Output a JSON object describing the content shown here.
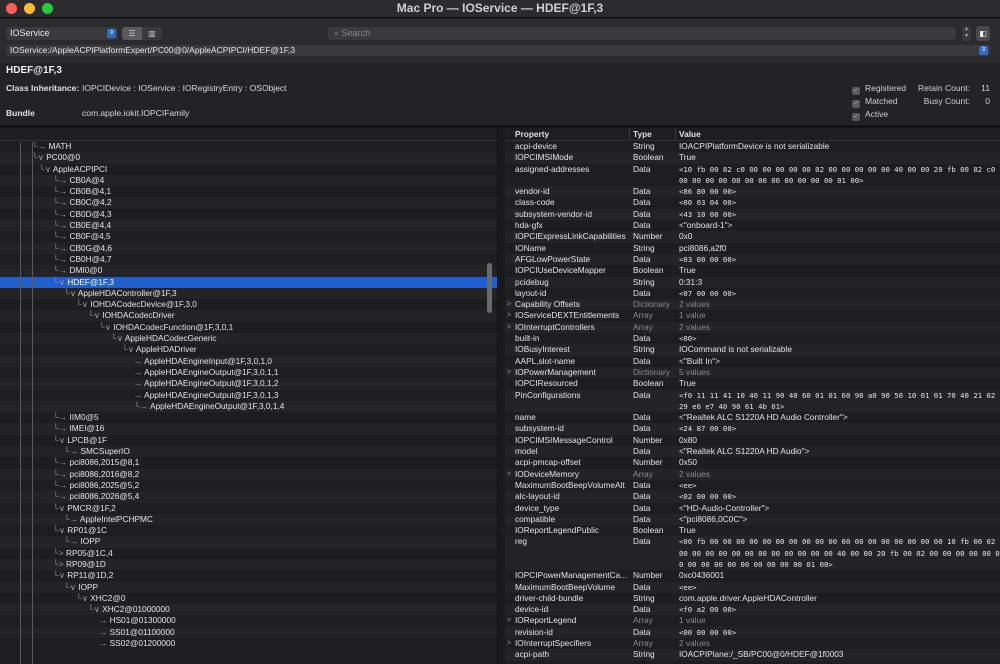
{
  "window": {
    "title": "Mac Pro — IOService — HDEF@1F,3"
  },
  "toolbar": {
    "plane": "IOService",
    "search_placeholder": "Search",
    "view_list_icon": "list-view-icon",
    "view_columns_icon": "column-view-icon",
    "path": "IOService:/AppleACPIPlatformExpert/PC00@0/AppleACPIPCI/HDEF@1F,3"
  },
  "info": {
    "name": "HDEF@1F,3",
    "class_label": "Class Inheritance:",
    "class_value": "IOPCIDevice : IOService : IORegistryEntry : OSObject",
    "bundle_label": "Bundle",
    "bundle_value": "com.apple.iokit.IOPCIFamily",
    "registered": "Registered",
    "matched": "Matched",
    "active": "Active",
    "retain_label": "Retain Count:",
    "retain_value": "11",
    "busy_label": "Busy Count:",
    "busy_value": "0"
  },
  "tree": [
    {
      "label": "MATH",
      "prefix": "└→ "
    },
    {
      "label": "PC00@0",
      "prefix": "└∨ "
    },
    {
      "label": "AppleACPIPCI",
      "prefix": "└∨ "
    },
    {
      "label": "CB0A@4",
      "prefix": "└→ "
    },
    {
      "label": "CB0B@4,1",
      "prefix": "└→ "
    },
    {
      "label": "CB0C@4,2",
      "prefix": "└→ "
    },
    {
      "label": "CB0D@4,3",
      "prefix": "└→ "
    },
    {
      "label": "CB0E@4,4",
      "prefix": "└→ "
    },
    {
      "label": "CB0F@4,5",
      "prefix": "└→ "
    },
    {
      "label": "CB0G@4,6",
      "prefix": "└→ "
    },
    {
      "label": "CB0H@4,7",
      "prefix": "└→ "
    },
    {
      "label": "DMI0@0",
      "prefix": "└→ "
    },
    {
      "label": "HDEF@1F,3",
      "prefix": "└∨ "
    },
    {
      "label": "AppleHDAController@1F,3",
      "prefix": "└∨ "
    },
    {
      "label": "IOHDACodecDevice@1F,3,0",
      "prefix": "└∨ "
    },
    {
      "label": "IOHDACodecDriver",
      "prefix": "└∨ "
    },
    {
      "label": "IOHDACodecFunction@1F,3,0,1",
      "prefix": "└∨ "
    },
    {
      "label": "AppleHDACodecGeneric",
      "prefix": "└∨ "
    },
    {
      "label": "AppleHDADriver",
      "prefix": "└∨ "
    },
    {
      "label": "AppleHDAEngineInput@1F,3,0,1,0",
      "prefix": "→ "
    },
    {
      "label": "AppleHDAEngineOutput@1F,3,0,1,1",
      "prefix": "→ "
    },
    {
      "label": "AppleHDAEngineOutput@1F,3,0,1,2",
      "prefix": "→ "
    },
    {
      "label": "AppleHDAEngineOutput@1F,3,0,1,3",
      "prefix": "→ "
    },
    {
      "label": "AppleHDAEngineOutput@1F,3,0,1,4",
      "prefix": "└→ "
    },
    {
      "label": "IIM0@5",
      "prefix": "└→ "
    },
    {
      "label": "IMEI@16",
      "prefix": "└→ "
    },
    {
      "label": "LPCB@1F",
      "prefix": "└∨ "
    },
    {
      "label": "SMCSuperIO",
      "prefix": "└→ "
    },
    {
      "label": "pci8086,2015@8,1",
      "prefix": "└→ "
    },
    {
      "label": "pci8086,2016@8,2",
      "prefix": "└→ "
    },
    {
      "label": "pci8086,2025@5,2",
      "prefix": "└→ "
    },
    {
      "label": "pci8086,2026@5,4",
      "prefix": "└→ "
    },
    {
      "label": "PMCR@1F,2",
      "prefix": "└∨ "
    },
    {
      "label": "AppleIntelPCHPMC",
      "prefix": "└→ "
    },
    {
      "label": "RP01@1C",
      "prefix": "└∨ "
    },
    {
      "label": "IOPP",
      "prefix": "└→ "
    },
    {
      "label": "RP05@1C,4",
      "prefix": "└> "
    },
    {
      "label": "RP09@1D",
      "prefix": "└> "
    },
    {
      "label": "RP11@1D,2",
      "prefix": "└∨ "
    },
    {
      "label": "IOPP",
      "prefix": "└∨ "
    },
    {
      "label": "XHC2@0",
      "prefix": "└∨ "
    },
    {
      "label": "XHC2@01000000",
      "prefix": "└∨ "
    },
    {
      "label": "HS01@01300000",
      "prefix": "→ "
    },
    {
      "label": "SS01@01100000",
      "prefix": "→ "
    },
    {
      "label": "SS02@01200000",
      "prefix": "→ "
    }
  ],
  "props_header": {
    "property": "Property",
    "type": "Type",
    "value": "Value"
  },
  "props": [
    {
      "p": "acpi-device",
      "t": "String",
      "v": "IOACPIPlatformDevice is not serializable",
      "mono": false
    },
    {
      "p": "IOPCIMSIMode",
      "t": "Boolean",
      "v": "True",
      "mono": false
    },
    {
      "p": "assigned-addresses",
      "t": "Data",
      "v": "<10 fb 00 82 c0 00 00 00 00 00 02 00 00 00 00 00 40 00 00 20 fb 00 82 c0 00 00 00 00 00 00 00 00 00 00 00 00 01 00>",
      "mono": true,
      "h": 3
    },
    {
      "p": "vendor-id",
      "t": "Data",
      "v": "<86 80 00 00>",
      "mono": true
    },
    {
      "p": "class-code",
      "t": "Data",
      "v": "<00 03 04 00>",
      "mono": true
    },
    {
      "p": "subsystem-vendor-id",
      "t": "Data",
      "v": "<43 10 00 00>",
      "mono": true
    },
    {
      "p": "hda-gfx",
      "t": "Data",
      "v": "<\"onboard-1\">",
      "mono": false
    },
    {
      "p": "IOPCIExpressLinkCapabilities",
      "t": "Number",
      "v": "0x0",
      "mono": false
    },
    {
      "p": "IOName",
      "t": "String",
      "v": "pci8086,a2f0",
      "mono": false
    },
    {
      "p": "AFGLowPowerState",
      "t": "Data",
      "v": "<03 00 00 00>",
      "mono": true
    },
    {
      "p": "IOPCIUseDeviceMapper",
      "t": "Boolean",
      "v": "True",
      "mono": false
    },
    {
      "p": "pcidebug",
      "t": "String",
      "v": "0:31:3",
      "mono": false
    },
    {
      "p": "layout-id",
      "t": "Data",
      "v": "<07 00 00 00>",
      "mono": true
    },
    {
      "p": "Capability Offsets",
      "t": "Dictionary",
      "v": "2 values",
      "mono": false,
      "dim": true,
      "disc": true
    },
    {
      "p": "IOServiceDEXTEntitlements",
      "t": "Array",
      "v": "1 value",
      "mono": false,
      "dim": true,
      "disc": true
    },
    {
      "p": "IOInterruptControllers",
      "t": "Array",
      "v": "2 values",
      "mono": false,
      "dim": true,
      "disc": true
    },
    {
      "p": "built-in",
      "t": "Data",
      "v": "<00>",
      "mono": true
    },
    {
      "p": "IOBusyInterest",
      "t": "String",
      "v": "IOCommand is not serializable",
      "mono": false
    },
    {
      "p": "AAPL,slot-name",
      "t": "Data",
      "v": "<\"Built In\">",
      "mono": false
    },
    {
      "p": "IOPowerManagement",
      "t": "Dictionary",
      "v": "5 values",
      "mono": false,
      "dim": true,
      "disc": true
    },
    {
      "p": "IOPCIResourced",
      "t": "Boolean",
      "v": "True",
      "mono": false
    },
    {
      "p": "PinConfigurations",
      "t": "Data",
      "v": "<f0 11 11 41 10 40 11 90 40 60 01 01 60 90 a0 90 50 10 01 01 70 40 21 02 29 e6 e7 40 90 61 4b 01>",
      "mono": true,
      "h": 3
    },
    {
      "p": "name",
      "t": "Data",
      "v": "<\"Realtek ALC S1220A HD Audio Controller\">",
      "mono": false
    },
    {
      "p": "subsystem-id",
      "t": "Data",
      "v": "<24 87 00 00>",
      "mono": true
    },
    {
      "p": "IOPCIMSIMessageControl",
      "t": "Number",
      "v": "0x80",
      "mono": false
    },
    {
      "p": "model",
      "t": "Data",
      "v": "<\"Realtek ALC S1220A HD Audio\">",
      "mono": false
    },
    {
      "p": "acpi-pmcap-offset",
      "t": "Number",
      "v": "0x50",
      "mono": false
    },
    {
      "p": "IODeviceMemory",
      "t": "Array",
      "v": "2 values",
      "mono": false,
      "dim": true,
      "disc": true
    },
    {
      "p": "MaximumBootBeepVolumeAlt",
      "t": "Data",
      "v": "<ee>",
      "mono": true
    },
    {
      "p": "alc-layout-id",
      "t": "Data",
      "v": "<02 00 00 00>",
      "mono": true
    },
    {
      "p": "device_type",
      "t": "Data",
      "v": "<\"HD-Audio-Controller\">",
      "mono": false
    },
    {
      "p": "compatible",
      "t": "Data",
      "v": "<\"pci8086,0C0C\">",
      "mono": false
    },
    {
      "p": "IOReportLegendPublic",
      "t": "Boolean",
      "v": "True",
      "mono": false
    },
    {
      "p": "reg",
      "t": "Data",
      "v": "<00 fb 00 00 00 00 00 00 00 00 00 00 00 00 00 00 00 00 00 00 10 fb 00 02 00 00 00 00 00 00 00 00 00 00 00 00 40 00 00 20 fb 00 02 00 00 00 00 00 00 00 00 00 00 00 00 00 00 00 01 00>",
      "mono": true,
      "h": 4
    },
    {
      "p": "IOPCIPowerManagementCa...",
      "t": "Number",
      "v": "0xc0436001",
      "mono": false
    },
    {
      "p": "MaximumBootBeepVolume",
      "t": "Data",
      "v": "<ee>",
      "mono": true
    },
    {
      "p": "driver-child-bundle",
      "t": "String",
      "v": "com.apple.driver.AppleHDAController",
      "mono": false
    },
    {
      "p": "device-id",
      "t": "Data",
      "v": "<f0 a2 00 00>",
      "mono": true
    },
    {
      "p": "IOReportLegend",
      "t": "Array",
      "v": "1 value",
      "mono": false,
      "dim": true,
      "disc": true
    },
    {
      "p": "revision-id",
      "t": "Data",
      "v": "<00 00 00 00>",
      "mono": true
    },
    {
      "p": "IOInterruptSpecifiers",
      "t": "Array",
      "v": "2 values",
      "mono": false,
      "dim": true,
      "disc": true
    },
    {
      "p": "acpi-path",
      "t": "String",
      "v": "IOACPIPlane:/_SB/PC00@0/HDEF@1f0003",
      "mono": false
    }
  ]
}
